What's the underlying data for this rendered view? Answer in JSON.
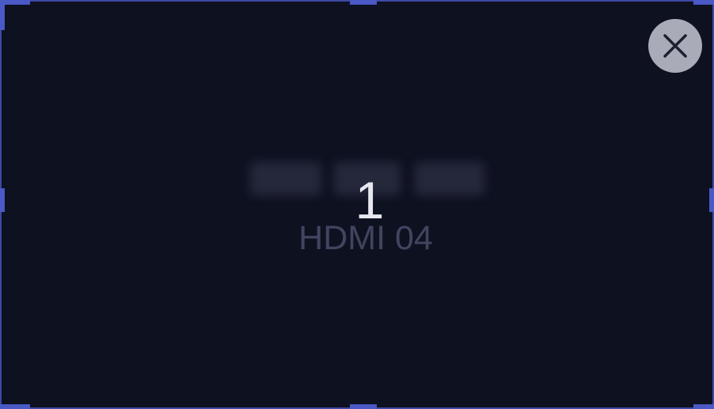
{
  "display": {
    "screen_number": "1",
    "source_label": "HDMI 04"
  },
  "controls": {
    "close_icon": "close-icon"
  },
  "colors": {
    "background": "#0e1120",
    "border": "#3d4aa3",
    "handle": "#4a59c6",
    "close_button": "#a9abb8",
    "number_text": "#e7e8ef",
    "source_text": "#40455f"
  }
}
